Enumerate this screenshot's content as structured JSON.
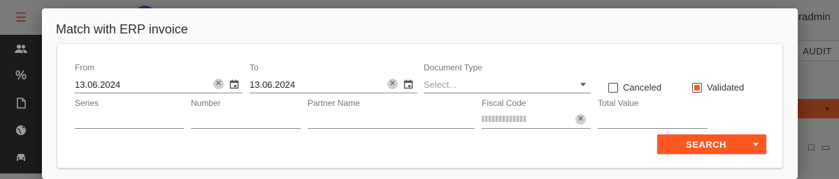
{
  "background": {
    "user_name": "radmin",
    "audit_label": "AUDIT",
    "sidebar_icons": [
      "people-icon",
      "percent-icon",
      "document-icon",
      "globe-icon",
      "car-icon"
    ]
  },
  "dialog": {
    "title": "Match with ERP invoice",
    "from": {
      "label": "From",
      "value": "13.06.2024"
    },
    "to": {
      "label": "To",
      "value": "13.06.2024"
    },
    "document_type": {
      "label": "Document Type",
      "placeholder": "Select..."
    },
    "canceled": {
      "label": "Canceled",
      "checked": false
    },
    "validated": {
      "label": "Validated",
      "checked": true
    },
    "series": {
      "label": "Series",
      "value": ""
    },
    "number": {
      "label": "Number",
      "value": ""
    },
    "partner_name": {
      "label": "Partner Name",
      "value": ""
    },
    "fiscal_code": {
      "label": "Fiscal Code",
      "value_masked": true
    },
    "total_value": {
      "label": "Total Value",
      "value": ""
    },
    "search_label": "SEARCH"
  },
  "colors": {
    "accent": "#ff5722",
    "sidebar": "#1b1b1b",
    "overlay": "#7b7b7b"
  }
}
